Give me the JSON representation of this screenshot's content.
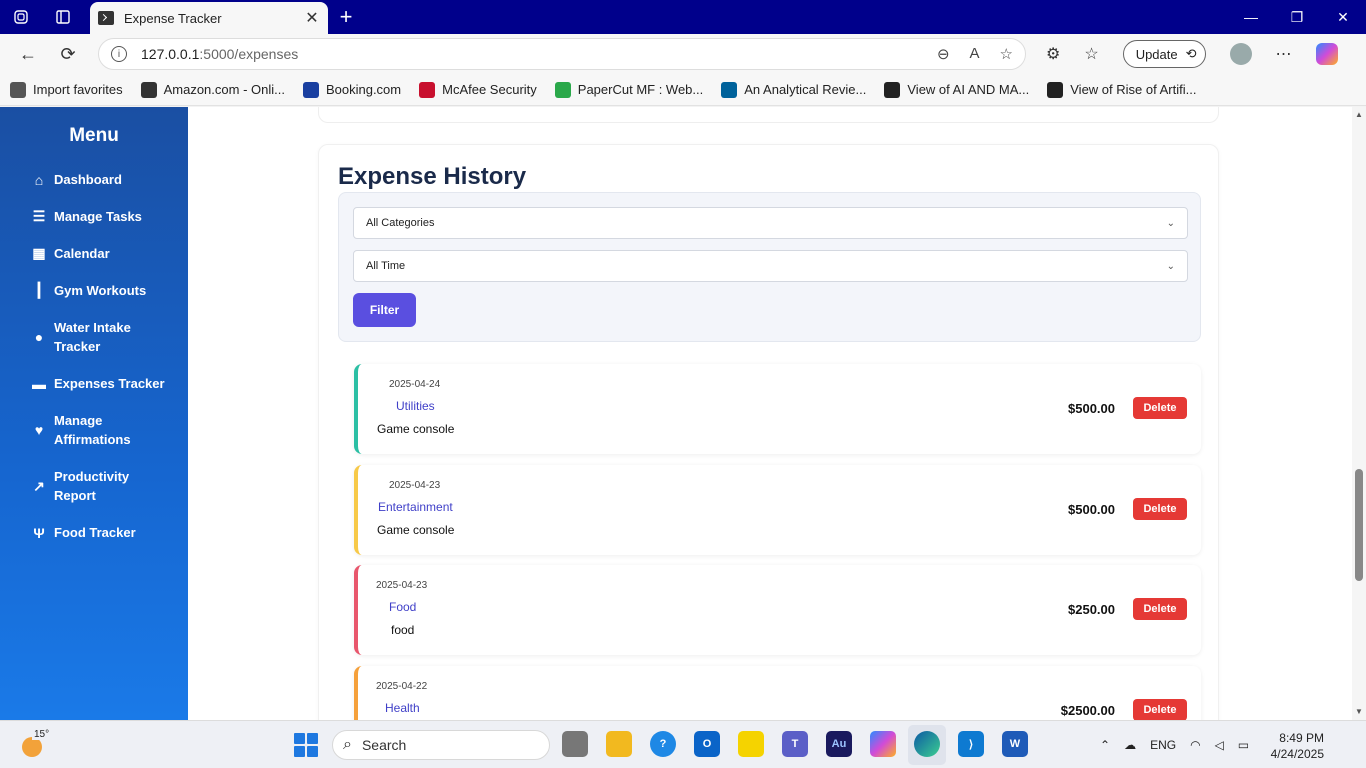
{
  "browser": {
    "tab_title": "Expense Tracker",
    "url_host": "127.0.0.1",
    "url_path": ":5000/expenses",
    "update_label": "Update",
    "favorites": [
      {
        "label": "Import favorites",
        "icon": "import-icon",
        "color": "#555555"
      },
      {
        "label": "Amazon.com - Onli...",
        "icon": "globe-icon",
        "color": "#333333"
      },
      {
        "label": "Booking.com",
        "icon": "booking-icon",
        "color": "#1a3fa0"
      },
      {
        "label": "McAfee Security",
        "icon": "mcafee-icon",
        "color": "#c8102e"
      },
      {
        "label": "PaperCut MF : Web...",
        "icon": "papercut-icon",
        "color": "#2aa84a"
      },
      {
        "label": "An Analytical Revie...",
        "icon": "ieee-icon",
        "color": "#00629b"
      },
      {
        "label": "View of AI AND MA...",
        "icon": "pkp-icon",
        "color": "#222222"
      },
      {
        "label": "View of Rise of Artifi...",
        "icon": "pkp-icon",
        "color": "#222222"
      }
    ]
  },
  "sidebar": {
    "title": "Menu",
    "items": [
      {
        "label": "Dashboard",
        "icon": "home-icon"
      },
      {
        "label": "Manage Tasks",
        "icon": "tasks-icon"
      },
      {
        "label": "Calendar",
        "icon": "calendar-icon"
      },
      {
        "label": "Gym Workouts",
        "icon": "dumbbell-icon"
      },
      {
        "label": "Water Intake Tracker",
        "icon": "water-drop-icon"
      },
      {
        "label": "Expenses Tracker",
        "icon": "money-icon"
      },
      {
        "label": "Manage Affirmations",
        "icon": "heart-icon"
      },
      {
        "label": "Productivity Report",
        "icon": "chart-line-icon"
      },
      {
        "label": "Food Tracker",
        "icon": "utensils-icon"
      }
    ]
  },
  "history": {
    "title": "Expense History",
    "category_select": "All Categories",
    "time_select": "All Time",
    "filter_label": "Filter",
    "delete_label": "Delete",
    "expenses": [
      {
        "date": "2025-04-24",
        "category": "Utilities",
        "description": "Game console",
        "amount": "$500.00",
        "color": "#2bbfa4"
      },
      {
        "date": "2025-04-23",
        "category": "Entertainment",
        "description": "Game console",
        "amount": "$500.00",
        "color": "#f7c948"
      },
      {
        "date": "2025-04-23",
        "category": "Food",
        "description": "food",
        "amount": "$250.00",
        "color": "#e8566c"
      },
      {
        "date": "2025-04-22",
        "category": "Health",
        "description": "",
        "amount": "$2500.00",
        "color": "#f5a03a"
      }
    ]
  },
  "taskbar": {
    "temperature": "15°",
    "search_placeholder": "Search",
    "language": "ENG",
    "time": "8:49 PM",
    "date": "4/24/2025"
  },
  "colors": {
    "accent": "#5a4fe0",
    "delete": "#e53935",
    "sidebar_top": "#1a4fa3",
    "sidebar_bottom": "#1a7ae8"
  }
}
